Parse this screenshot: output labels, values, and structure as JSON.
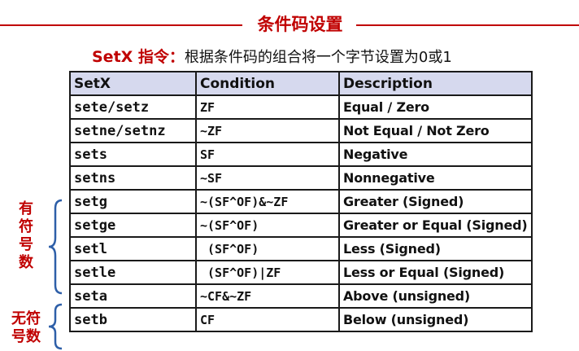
{
  "slide": {
    "title": "条件码设置",
    "subtitle_key": "SetX 指令：",
    "subtitle_text": "根据条件码的组合将一个字节设置为0或1"
  },
  "table": {
    "headers": [
      "SetX",
      "Condition",
      "Description"
    ],
    "rows": [
      {
        "instr": "sete/setz",
        "cond": "ZF",
        "desc": "Equal / Zero"
      },
      {
        "instr": "setne/setnz",
        "cond": "~ZF",
        "desc": "Not Equal / Not Zero"
      },
      {
        "instr": "sets",
        "cond": "SF",
        "desc": "Negative"
      },
      {
        "instr": "setns",
        "cond": "~SF",
        "desc": "Nonnegative"
      },
      {
        "instr": "setg",
        "cond": "~(SF^OF)&~ZF",
        "desc": "Greater (Signed)"
      },
      {
        "instr": "setge",
        "cond": "~(SF^OF)",
        "desc": "Greater or Equal (Signed)"
      },
      {
        "instr": "setl",
        "cond": " (SF^OF)",
        "desc": "Less (Signed)"
      },
      {
        "instr": "setle",
        "cond": " (SF^OF)|ZF",
        "desc": "Less or Equal (Signed)"
      },
      {
        "instr": "seta",
        "cond": "~CF&~ZF",
        "desc": "Above (unsigned)"
      },
      {
        "instr": "setb",
        "cond": "CF",
        "desc": "Below (unsigned)"
      }
    ]
  },
  "annotations": {
    "signed": [
      "有",
      "符",
      "号",
      "数"
    ],
    "unsigned": [
      "无符",
      "号数"
    ]
  }
}
